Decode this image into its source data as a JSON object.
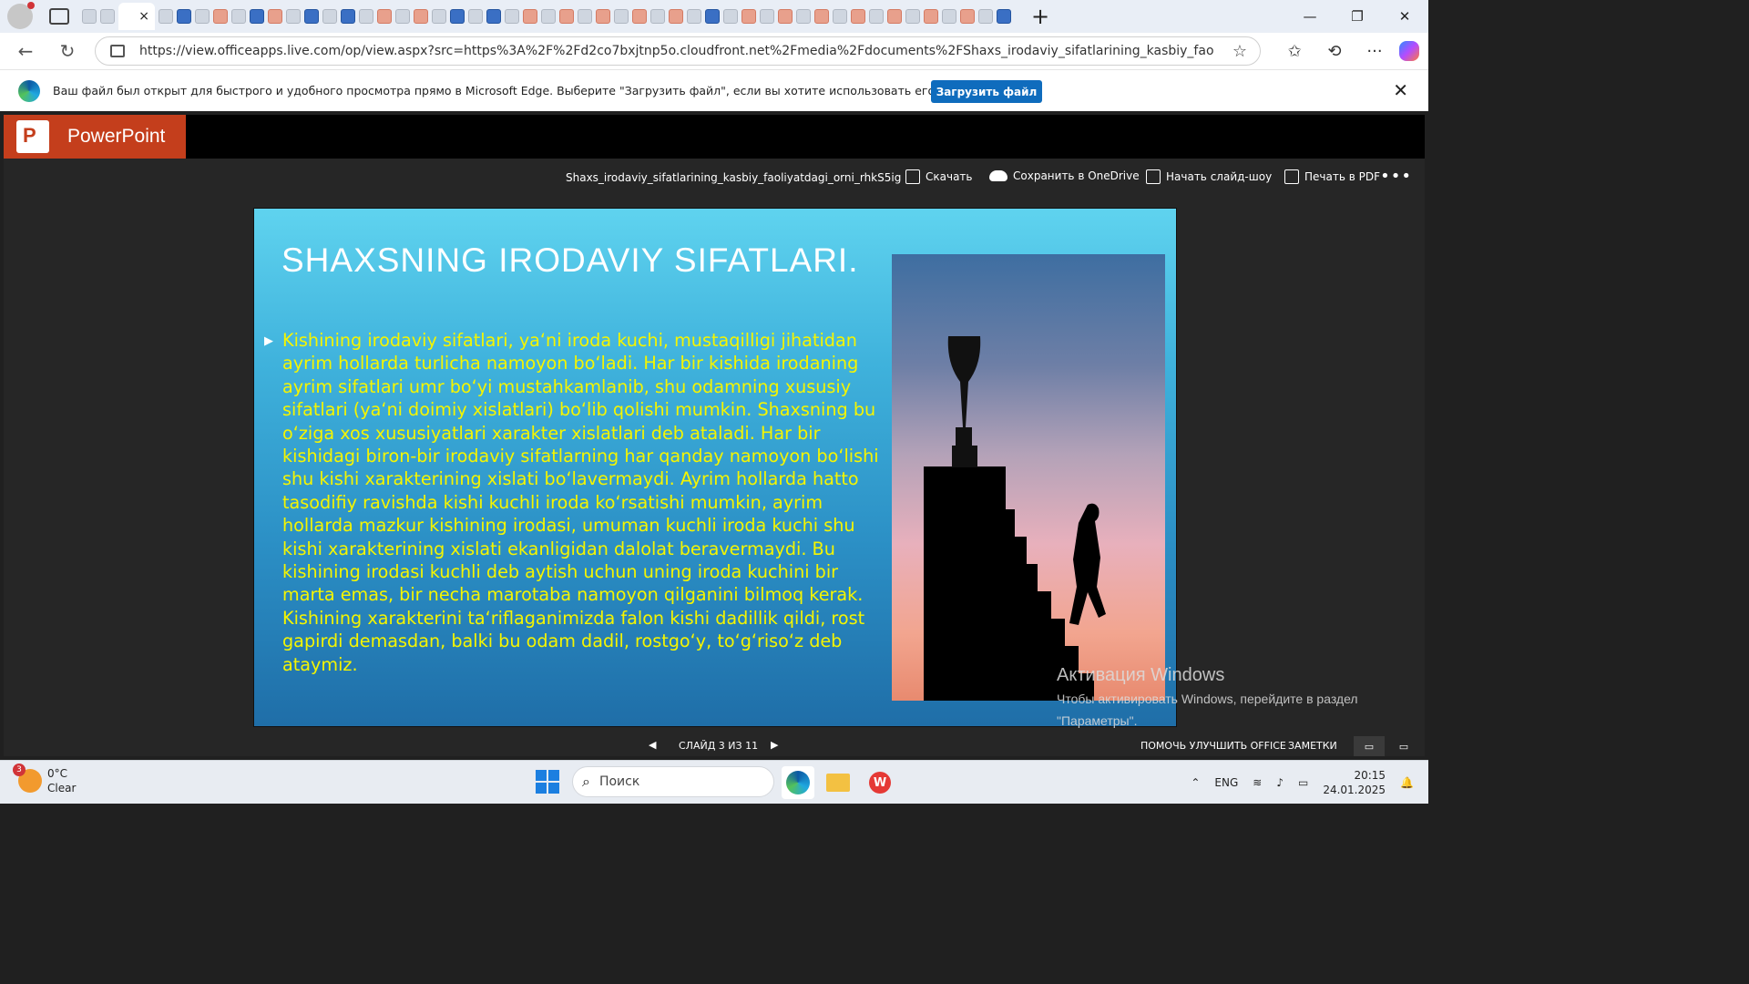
{
  "browser": {
    "url": "https://view.officeapps.live.com/op/view.aspx?src=https%3A%2F%2Fd2co7bxjtnp5o.cloudfront.net%2Fmedia%2Fdocuments%2FShaxs_irodaviy_sifatlarining_kasbiy_faoliyatdagi_orni_rhkS...",
    "tab_close": "×",
    "new_tab": "+",
    "window_controls": [
      "—",
      "❐",
      "✕"
    ]
  },
  "infobar": {
    "message": "Ваш файл был открыт для быстрого и удобного просмотра прямо в Microsoft Edge. Выберите \"Загрузить файл\", если вы хотите использовать его позже.",
    "button": "Загрузить файл",
    "close": "✕"
  },
  "app": {
    "name": "PowerPoint",
    "filename": "Shaxs_irodaviy_sifatlarining_kasbiy_faoliyatdagi_orni_rhkS5ig",
    "actions": [
      "Скачать",
      "Сохранить в OneDrive",
      "Начать слайд-шоу",
      "Печать в PDF"
    ],
    "more": "•••"
  },
  "slide": {
    "title": "SHAXSNING IRODAVIY SIFATLARI.",
    "bullet": "▶",
    "body": "Kishining irodaviy sifatlari, ya‘ni iroda kuchi, mustaqilligi jihatidan ayrim hollarda turlicha namoyon bo‘ladi. Har bir kishida irodaning ayrim sifatlari umr bo‘yi mustahkamlanib, shu odamning xususiy sifatlari (ya‘ni doimiy xislatlari) bo‘lib qolishi mumkin. Shaxsning bu o‘ziga xos xususiyatlari xarakter xislatlari deb ataladi. Har bir kishidagi biron-bir irodaviy sifatlarning har qanday namoyon bo‘lishi shu kishi xarakterining xislati bo‘lavermaydi. Ayrim hollarda hatto tasodifiy ravishda kishi kuchli iroda ko‘rsatishi mumkin, ayrim hollarda mazkur kishining irodasi, umuman kuchli iroda kuchi shu kishi xarakterining xislati ekanligidan dalolat beravermaydi. Bu kishining irodasi kuchli deb aytish uchun uning iroda kuchini bir marta emas, bir necha marotaba namoyon qilganini bilmoq kerak. Kishining xarakterini ta‘riflaganimizda falon kishi dadillik qildi, rost gapirdi demasdan, balki bu odam dadil, rostgo‘y, to‘g‘riso‘z deb ataymiz."
  },
  "status": {
    "prev": "◀",
    "slide_counter": "СЛАЙД 3 ИЗ 11",
    "next": "▶",
    "help": "ПОМОЧЬ УЛУЧШИТЬ OFFICE",
    "notes": "ЗАМЕТКИ"
  },
  "watermark": {
    "line1": "Активация Windows",
    "line2": "Чтобы активировать Windows, перейдите в раздел",
    "line3": "\"Параметры\"."
  },
  "taskbar": {
    "weather_badge": "3",
    "temperature": "0°C",
    "condition": "Clear",
    "search_placeholder": "Поиск",
    "language": "ENG",
    "time": "20:15",
    "date": "24.01.2025"
  }
}
